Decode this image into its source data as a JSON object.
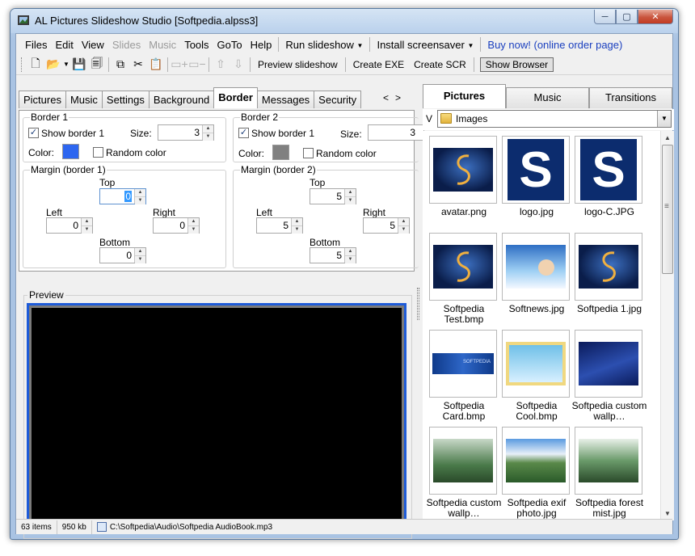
{
  "window": {
    "title": "AL Pictures Slideshow Studio [Softpedia.alpss3]",
    "buttons": {
      "minimize": "─",
      "maximize": "▢",
      "close": "✕"
    }
  },
  "menubar": {
    "files": "Files",
    "edit": "Edit",
    "view": "View",
    "slides": "Slides",
    "music": "Music",
    "tools": "Tools",
    "goto": "GoTo",
    "help": "Help",
    "run_slideshow": "Run slideshow",
    "install_screensaver": "Install screensaver",
    "buy_now": "Buy now! (online order page)"
  },
  "toolbar": {
    "preview_slideshow": "Preview slideshow",
    "create_exe": "Create EXE",
    "create_scr": "Create SCR",
    "show_browser": "Show Browser"
  },
  "tabs": [
    "Pictures",
    "Music",
    "Settings",
    "Background",
    "Border",
    "Messages",
    "Security"
  ],
  "active_tab": "Border",
  "tab_arrows": {
    "left": "<",
    "right": ">"
  },
  "border1": {
    "caption": "Border 1",
    "show_border_label": "Show border 1",
    "show_border_checked": "✓",
    "size_label": "Size:",
    "size_value": "3",
    "color_label": "Color:",
    "color": "#2d66f0",
    "random_color_label": "Random color"
  },
  "border2": {
    "caption": "Border 2",
    "show_border_label": "Show border 1",
    "show_border_checked": "✓",
    "size_label": "Size:",
    "size_value": "3",
    "color_label": "Color:",
    "color": "#808080",
    "random_color_label": "Random color"
  },
  "margin1": {
    "caption": "Margin (border 1)",
    "top_label": "Top",
    "top_value": "0",
    "left_label": "Left",
    "left_value": "0",
    "right_label": "Right",
    "right_value": "0",
    "bottom_label": "Bottom",
    "bottom_value": "0"
  },
  "margin2": {
    "caption": "Margin (border 2)",
    "top_label": "Top",
    "top_value": "5",
    "left_label": "Left",
    "left_value": "5",
    "right_label": "Right",
    "right_value": "5",
    "bottom_label": "Bottom",
    "bottom_value": "5"
  },
  "preview": {
    "caption": "Preview"
  },
  "browser": {
    "tabs": [
      "Pictures",
      "Music",
      "Transitions"
    ],
    "active_tab": "Pictures",
    "view_label": "V",
    "folder": "Images",
    "items": [
      {
        "name": "avatar.png",
        "kind": "swirl"
      },
      {
        "name": "logo.jpg",
        "kind": "logo"
      },
      {
        "name": "logo-C.JPG",
        "kind": "logo"
      },
      {
        "name": "Softpedia Test.bmp",
        "kind": "swirl"
      },
      {
        "name": "Softnews.jpg",
        "kind": "sky"
      },
      {
        "name": "Softpedia 1.jpg",
        "kind": "swirl"
      },
      {
        "name": "Softpedia Card.bmp",
        "kind": "banner"
      },
      {
        "name": "Softpedia Cool.bmp",
        "kind": "cool"
      },
      {
        "name": "Softpedia custom wallp…",
        "kind": "wave"
      },
      {
        "name": "Softpedia custom wallp…",
        "kind": "forest"
      },
      {
        "name": "Softpedia exif photo.jpg",
        "kind": "valley"
      },
      {
        "name": "Softpedia forest mist.jpg",
        "kind": "mist"
      }
    ]
  },
  "statusbar": {
    "items_count": "63 items",
    "size": "950 kb",
    "audio_file": "C:\\Softpedia\\Audio\\Softpedia AudioBook.mp3"
  }
}
